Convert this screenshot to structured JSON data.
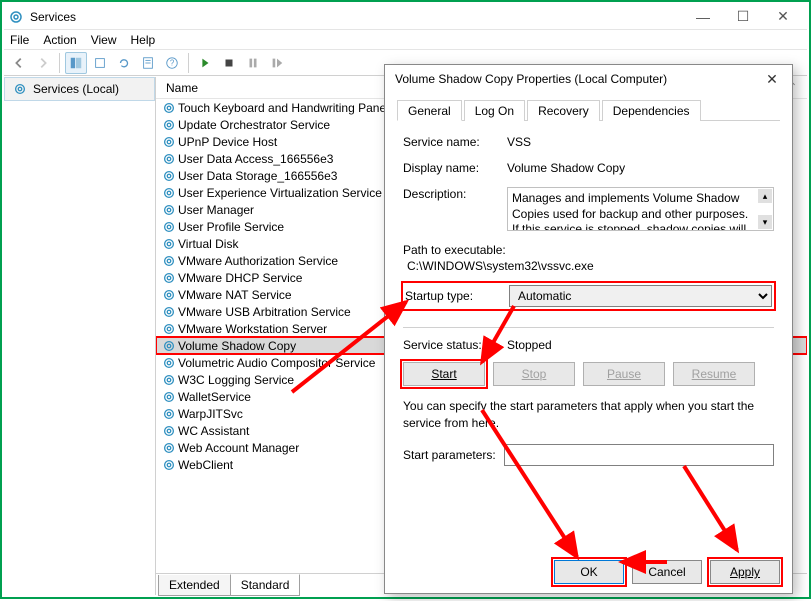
{
  "window": {
    "title": "Services",
    "menu": [
      "File",
      "Action",
      "View",
      "Help"
    ]
  },
  "left_panel": {
    "item": "Services (Local)"
  },
  "list": {
    "header": "Name",
    "items": [
      "Touch Keyboard and Handwriting Panel Ser",
      "Update Orchestrator Service",
      "UPnP Device Host",
      "User Data Access_166556e3",
      "User Data Storage_166556e3",
      "User Experience Virtualization Service",
      "User Manager",
      "User Profile Service",
      "Virtual Disk",
      "VMware Authorization Service",
      "VMware DHCP Service",
      "VMware NAT Service",
      "VMware USB Arbitration Service",
      "VMware Workstation Server",
      "Volume Shadow Copy",
      "Volumetric Audio Compositor Service",
      "W3C Logging Service",
      "WalletService",
      "WarpJITSvc",
      "WC Assistant",
      "Web Account Manager",
      "WebClient"
    ],
    "selected_index": 14
  },
  "tabs": {
    "extended": "Extended",
    "standard": "Standard"
  },
  "dialog": {
    "title": "Volume Shadow Copy Properties (Local Computer)",
    "tabs": [
      "General",
      "Log On",
      "Recovery",
      "Dependencies"
    ],
    "service_name_label": "Service name:",
    "service_name": "VSS",
    "display_name_label": "Display name:",
    "display_name": "Volume Shadow Copy",
    "description_label": "Description:",
    "description": "Manages and implements Volume Shadow Copies used for backup and other purposes. If this service is stopped, shadow copies will be",
    "path_label": "Path to executable:",
    "path": "C:\\WINDOWS\\system32\\vssvc.exe",
    "startup_label": "Startup type:",
    "startup_value": "Automatic",
    "status_label": "Service status:",
    "status_value": "Stopped",
    "buttons": {
      "start": "Start",
      "stop": "Stop",
      "pause": "Pause",
      "resume": "Resume"
    },
    "help": "You can specify the start parameters that apply when you start the service from here.",
    "param_label": "Start parameters:",
    "footer": {
      "ok": "OK",
      "cancel": "Cancel",
      "apply": "Apply"
    }
  }
}
